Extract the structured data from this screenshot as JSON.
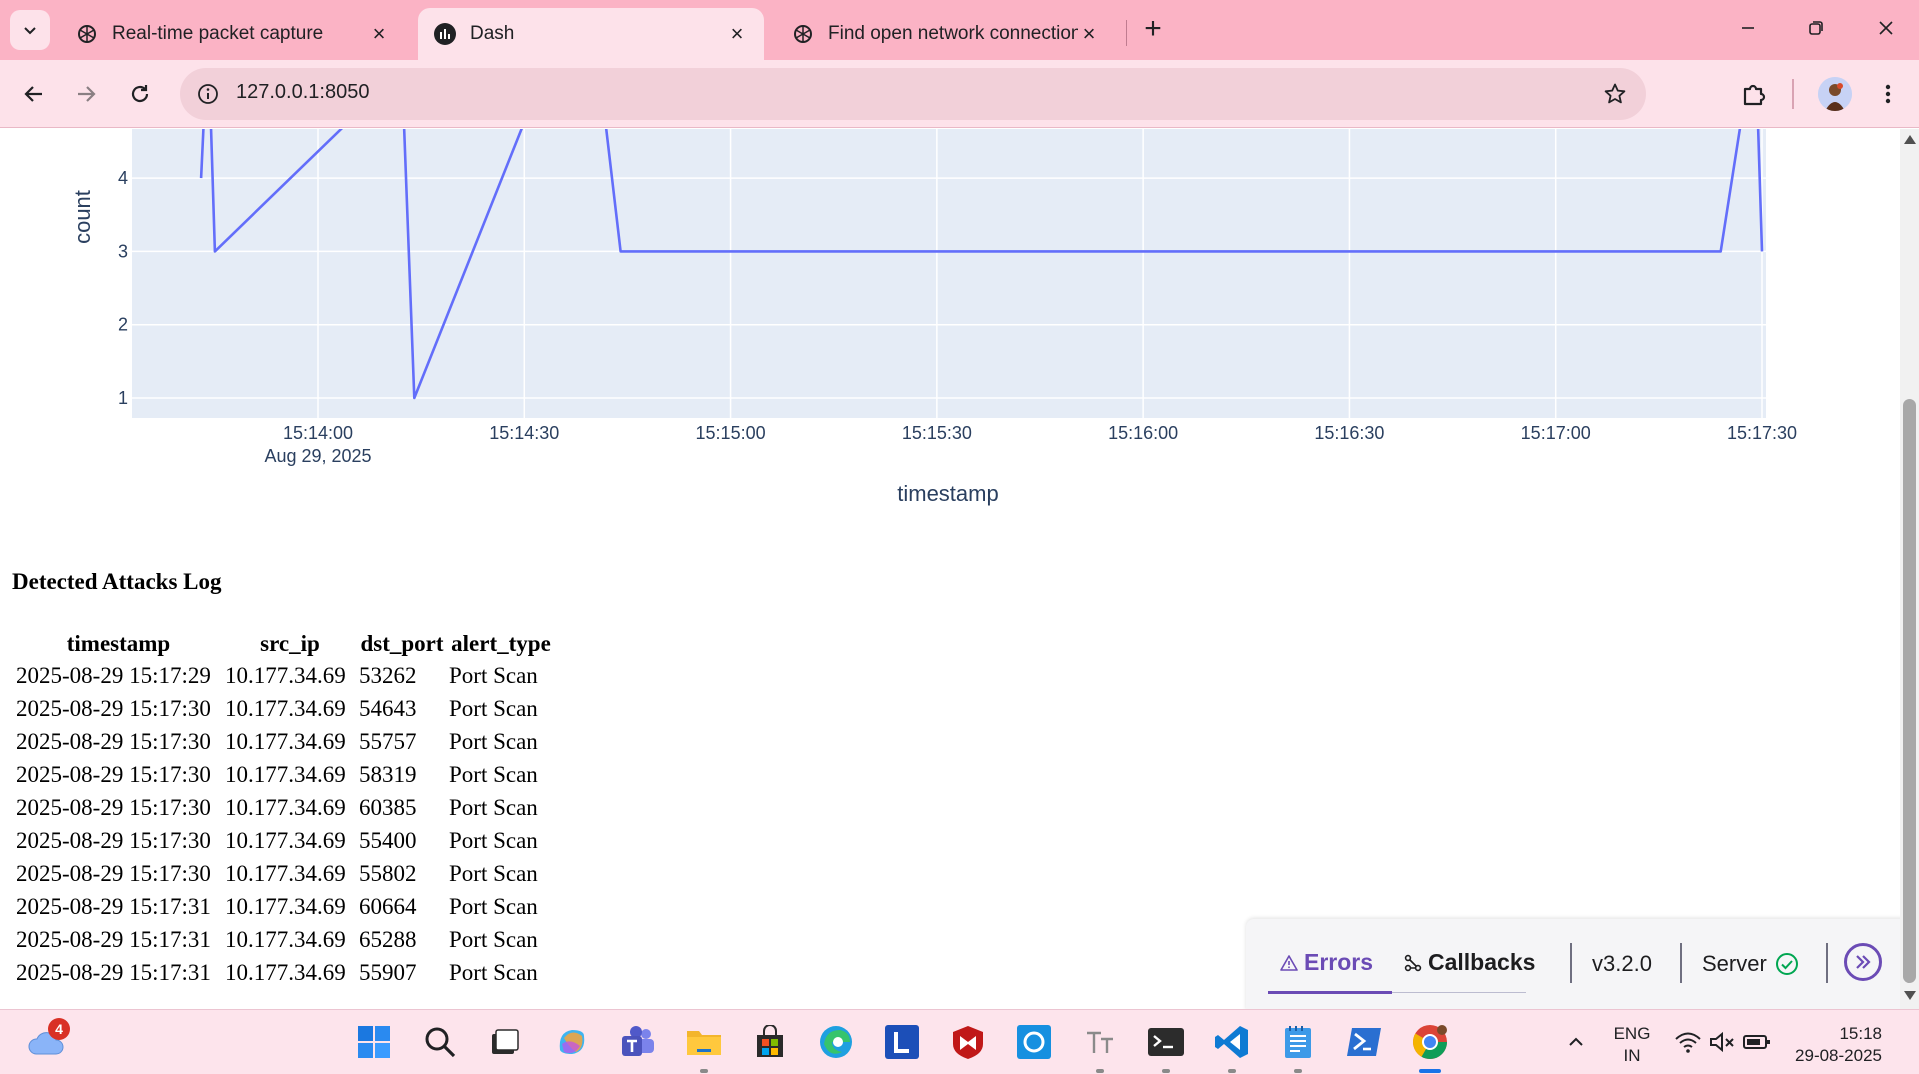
{
  "browser": {
    "tabs": [
      {
        "title": "Real-time packet capture",
        "icon": "openai-icon",
        "active": false
      },
      {
        "title": "Dash",
        "icon": "dash-icon",
        "active": true
      },
      {
        "title": "Find open network connections",
        "icon": "openai-icon",
        "active": false
      }
    ],
    "url": "127.0.0.1:8050"
  },
  "chart_data": {
    "type": "line",
    "xlabel": "timestamp",
    "ylabel": "count",
    "x_tick_labels": [
      "15:14:00",
      "15:14:30",
      "15:15:00",
      "15:15:30",
      "15:16:00",
      "15:16:30",
      "15:17:00",
      "15:17:30"
    ],
    "x_date_label": "Aug 29, 2025",
    "y_tick_labels": [
      "1",
      "2",
      "3",
      "4"
    ],
    "visible_y_range": [
      0.73,
      4.65
    ],
    "x_range": [
      "2025-08-29 15:13:43",
      "2025-08-29 15:17:30"
    ],
    "series": [
      {
        "color": "#636efa",
        "points": [
          {
            "x": "2025-08-29 15:13:43",
            "y": 4
          },
          {
            "x": "2025-08-29 15:13:44",
            "y": 6
          },
          {
            "x": "2025-08-29 15:13:45",
            "y": 3
          },
          {
            "x": "2025-08-29 15:14:07",
            "y": 5
          },
          {
            "x": "2025-08-29 15:14:12",
            "y": 6
          },
          {
            "x": "2025-08-29 15:14:14",
            "y": 1
          },
          {
            "x": "2025-08-29 15:14:31",
            "y": 5
          },
          {
            "x": "2025-08-29 15:14:39",
            "y": 7
          },
          {
            "x": "2025-08-29 15:14:44",
            "y": 3
          },
          {
            "x": "2025-08-29 15:17:24",
            "y": 3
          },
          {
            "x": "2025-08-29 15:17:29",
            "y": 6
          },
          {
            "x": "2025-08-29 15:17:30",
            "y": 3
          }
        ]
      }
    ]
  },
  "log": {
    "title": "Detected Attacks Log",
    "columns": [
      "timestamp",
      "src_ip",
      "dst_port",
      "alert_type"
    ],
    "rows": [
      [
        "2025-08-29 15:17:29",
        "10.177.34.69",
        "53262",
        "Port Scan"
      ],
      [
        "2025-08-29 15:17:30",
        "10.177.34.69",
        "54643",
        "Port Scan"
      ],
      [
        "2025-08-29 15:17:30",
        "10.177.34.69",
        "55757",
        "Port Scan"
      ],
      [
        "2025-08-29 15:17:30",
        "10.177.34.69",
        "58319",
        "Port Scan"
      ],
      [
        "2025-08-29 15:17:30",
        "10.177.34.69",
        "60385",
        "Port Scan"
      ],
      [
        "2025-08-29 15:17:30",
        "10.177.34.69",
        "55400",
        "Port Scan"
      ],
      [
        "2025-08-29 15:17:30",
        "10.177.34.69",
        "55802",
        "Port Scan"
      ],
      [
        "2025-08-29 15:17:31",
        "10.177.34.69",
        "60664",
        "Port Scan"
      ],
      [
        "2025-08-29 15:17:31",
        "10.177.34.69",
        "65288",
        "Port Scan"
      ],
      [
        "2025-08-29 15:17:31",
        "10.177.34.69",
        "55907",
        "Port Scan"
      ]
    ]
  },
  "dash_debug": {
    "errors_label": "Errors",
    "callbacks_label": "Callbacks",
    "version": "v3.2.0",
    "server_label": "Server"
  },
  "taskbar": {
    "weather_badge": "4",
    "lang_line1": "ENG",
    "lang_line2": "IN",
    "time": "15:18",
    "date": "29-08-2025"
  },
  "colors": {
    "plot_bg": "#e5ecf6",
    "line": "#636efa",
    "tabstrip": "#fbb3c5",
    "accent": "#6b4bb5"
  }
}
